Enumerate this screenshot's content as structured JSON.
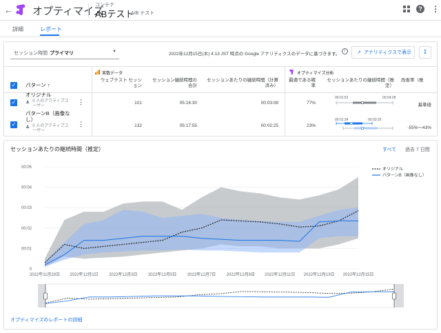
{
  "header": {
    "back_icon": "arrow-back-icon",
    "app_title": "オプティマイズ",
    "container_label": "コンテナ",
    "experiment_name": "ABテスト",
    "experiment_type": "A/B テスト",
    "logo_color": "#a142f4"
  },
  "tabs": [
    {
      "label": "詳細",
      "active": false
    },
    {
      "label": "レポート",
      "active": true
    }
  ],
  "toolbar": {
    "metric_label": "セッション時間",
    "metric_value": "プライマリ",
    "data_note": "2022年12月15日(木) 4:13 JST 時点の Google アナリティクスのデータに基づきます。",
    "ga_button": "アナリティクスで表示"
  },
  "table": {
    "variant_header": "パターン",
    "section_actual": "実数データ",
    "section_optimize": "オプティマイズ分析",
    "columns": [
      "ウェブテスト セッション",
      "セッション継続時間の合計",
      "セッションあたりの継続時間（計算済み）",
      "最適である確率",
      "セッションあたりの継続時間（推定）",
      "改善率（推"
    ],
    "rows": [
      {
        "name": "オリジナル",
        "users": "0 人のアクティブユーザー",
        "sessions": "101",
        "total_duration": "05:16:30",
        "avg_duration": "00:03:08",
        "probability": "77%",
        "range_low": "00:01:52",
        "range_high": "00:04:28",
        "improvement": "基準値",
        "color": "#5f6368"
      },
      {
        "name": "パターンB（画像なし）",
        "users": "0 人のアクティブユーザー",
        "sessions": "132",
        "total_duration": "05:17:55",
        "avg_duration": "00:02:25",
        "probability": "23%",
        "range_low": "00:01:34",
        "range_high": "00:03:29",
        "improvement": "-55%～43%",
        "color": "#1a73e8"
      }
    ]
  },
  "chart": {
    "title": "セッションあたりの継続時間（推定）",
    "range_all": "すべて",
    "range_7d": "過去 7 日間",
    "footer_link": "オプティマイズのレポートの詳細"
  },
  "chart_data": {
    "type": "line",
    "x": [
      "2022年11月29日",
      "2022年11月30日",
      "2022年12月1日",
      "2022年12月2日",
      "2022年12月3日",
      "2022年12月4日",
      "2022年12月5日",
      "2022年12月6日",
      "2022年12月7日",
      "2022年12月8日",
      "2022年12月9日",
      "2022年12月10日",
      "2022年12月11日",
      "2022年12月12日",
      "2022年12月13日",
      "2022年12月14日",
      "2022年12月15日"
    ],
    "x_tick_labels": [
      "2022年11月29日",
      "2022年12月1日",
      "2022年12月3日",
      "2022年12月5日",
      "2022年12月7日",
      "2022年12月9日",
      "2022年12月11日",
      "2022年12月13日",
      "2022年12月15日"
    ],
    "y_ticks": [
      "0",
      "00:01",
      "00:02",
      "00:03",
      "00:04",
      "00:05"
    ],
    "ylim": [
      0,
      5
    ],
    "yunit": "minutes",
    "series": [
      {
        "name": "オリジナル",
        "color": "#202124",
        "dash": true,
        "values": [
          0.3,
          1.2,
          1.0,
          1.1,
          1.2,
          1.3,
          1.4,
          1.8,
          2.0,
          2.4,
          2.35,
          2.3,
          2.2,
          2.05,
          2.1,
          2.35,
          2.85
        ],
        "upper": [
          0.5,
          2.4,
          2.8,
          2.8,
          3.2,
          3.3,
          3.3,
          2.9,
          3.5,
          4.0,
          3.8,
          3.7,
          3.5,
          3.4,
          3.6,
          3.9,
          4.5
        ],
        "lower": [
          0.1,
          0.6,
          0.5,
          0.55,
          0.6,
          0.7,
          0.8,
          0.9,
          1.0,
          1.2,
          1.1,
          1.1,
          1.0,
          1.0,
          1.0,
          1.2,
          1.5
        ]
      },
      {
        "name": "パターンB（画像なし）",
        "color": "#1a73e8",
        "dash": false,
        "values": [
          0.2,
          0.7,
          1.4,
          1.4,
          1.5,
          1.6,
          1.6,
          1.6,
          1.5,
          1.45,
          1.4,
          1.4,
          1.4,
          1.35,
          2.3,
          2.35,
          2.35
        ],
        "upper": [
          0.35,
          1.3,
          2.2,
          2.4,
          2.9,
          2.8,
          2.5,
          2.6,
          2.7,
          2.5,
          2.4,
          2.35,
          2.3,
          2.3,
          2.6,
          2.9,
          3.0
        ],
        "lower": [
          0.1,
          0.45,
          0.7,
          0.8,
          0.85,
          0.9,
          0.9,
          0.95,
          0.9,
          0.9,
          0.85,
          0.8,
          0.8,
          0.8,
          1.5,
          1.6,
          1.6
        ]
      }
    ]
  }
}
